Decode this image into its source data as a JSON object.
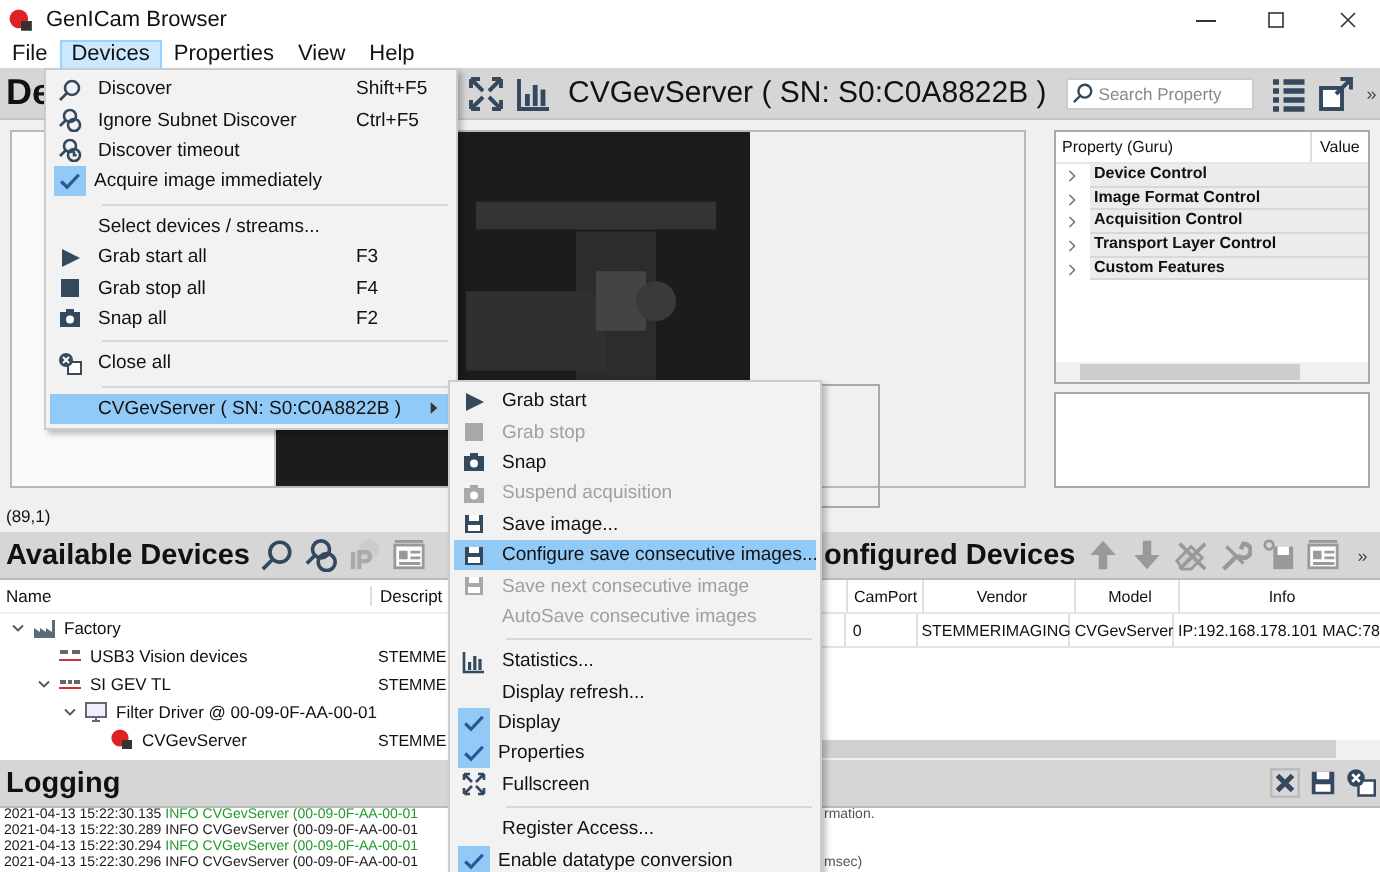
{
  "window": {
    "title": "GenICam Browser"
  },
  "menu_bar": [
    {
      "label": "File",
      "selected": false
    },
    {
      "label": "Devices",
      "selected": true
    },
    {
      "label": "Properties",
      "selected": false
    },
    {
      "label": "View",
      "selected": false
    },
    {
      "label": "Help",
      "selected": false
    }
  ],
  "device_toolbar": {
    "heading": "De",
    "device": "CVGevServer ( SN: S0:C0A8822B )",
    "search": {
      "placeholder": "Search Property"
    },
    "overflow": "»"
  },
  "image_panel": {
    "cursor": "(89,1)"
  },
  "property_tree": {
    "columns": [
      "Property (Guru)",
      "Value"
    ],
    "rows": [
      {
        "label": "Device Control",
        "expanded": false
      },
      {
        "label": "Image Format Control",
        "expanded": false
      },
      {
        "label": "Acquisition Control",
        "expanded": false
      },
      {
        "label": "Transport Layer Control",
        "expanded": false
      },
      {
        "label": "Custom Features",
        "expanded": false
      }
    ]
  },
  "available_devices": {
    "title": "Available Devices",
    "columns": [
      "Name",
      "Descript"
    ],
    "tree": [
      {
        "label": "Factory",
        "expanded": true,
        "children": [
          {
            "label": "USB3 Vision devices",
            "description": "STEMME"
          },
          {
            "label": "SI GEV TL",
            "description": "STEMME",
            "expanded": true,
            "children": [
              {
                "label": "Filter Driver @ 00-09-0F-AA-00-01",
                "expanded": true,
                "children": [
                  {
                    "label": "CVGevServer",
                    "description": "STEMME"
                  }
                ]
              }
            ]
          }
        ]
      }
    ]
  },
  "configured_devices": {
    "title": "onfigured Devices",
    "overflow": "»",
    "columns": [
      "CamPort",
      "Vendor",
      "Model",
      "Info"
    ],
    "rows": [
      [
        "0",
        "STEMMERIMAGING",
        "CVGevServer",
        "IP:192.168.178.101  MAC:78"
      ]
    ]
  },
  "logging": {
    "title": "Logging",
    "lines": [
      {
        "time": "2021-04-13 15:22:30.135",
        "message": "INFO CVGevServer (00-09-0F-AA-00-01",
        "color": "#1f9a2a",
        "tail": "rmation."
      },
      {
        "time": "2021-04-13 15:22:30.289",
        "message": "INFO CVGevServer (00-09-0F-AA-00-01",
        "color": "#1a1a1a"
      },
      {
        "time": "2021-04-13 15:22:30.294",
        "message": "INFO CVGevServer (00-09-0F-AA-00-01",
        "color": "#1f9a2a"
      },
      {
        "time": "2021-04-13 15:22:30.296",
        "message": "INFO CVGevServer (00-09-0F-AA-00-01",
        "color": "#1a1a1a",
        "tail": "msec)"
      }
    ]
  },
  "devices_menu": {
    "items": [
      {
        "kind": "item",
        "label": "Discover",
        "shortcut": "Shift+F5",
        "checked": false,
        "disabled": false,
        "selected": false
      },
      {
        "kind": "item",
        "label": "Ignore Subnet Discover",
        "shortcut": "Ctrl+F5",
        "checked": false,
        "disabled": false,
        "selected": false
      },
      {
        "kind": "item",
        "label": "Discover timeout",
        "checked": false,
        "disabled": false,
        "selected": false
      },
      {
        "kind": "item",
        "label": "Acquire image immediately",
        "checked": true,
        "disabled": false,
        "selected": false
      },
      {
        "kind": "separator"
      },
      {
        "kind": "item",
        "label": "Select devices / streams...",
        "checked": false,
        "disabled": false,
        "selected": false
      },
      {
        "kind": "item",
        "label": "Grab start all",
        "shortcut": "F3",
        "checked": false,
        "disabled": false,
        "selected": false
      },
      {
        "kind": "item",
        "label": "Grab stop all",
        "shortcut": "F4",
        "checked": false,
        "disabled": false,
        "selected": false
      },
      {
        "kind": "item",
        "label": "Snap all",
        "shortcut": "F2",
        "checked": false,
        "disabled": false,
        "selected": false
      },
      {
        "kind": "separator"
      },
      {
        "kind": "item",
        "label": "Close all",
        "checked": false,
        "disabled": false,
        "selected": false
      },
      {
        "kind": "separator"
      },
      {
        "kind": "submenu",
        "label": "CVGevServer ( SN: S0:C0A8822B )",
        "checked": false,
        "disabled": false,
        "selected": true
      }
    ]
  },
  "device_submenu": {
    "items": [
      {
        "kind": "item",
        "label": "Grab start",
        "checked": false,
        "disabled": false,
        "selected": false
      },
      {
        "kind": "item",
        "label": "Grab stop",
        "checked": false,
        "disabled": true,
        "selected": false
      },
      {
        "kind": "item",
        "label": "Snap",
        "checked": false,
        "disabled": false,
        "selected": false
      },
      {
        "kind": "item",
        "label": "Suspend acquisition",
        "checked": false,
        "disabled": true,
        "selected": false
      },
      {
        "kind": "item",
        "label": "Save image...",
        "checked": false,
        "disabled": false,
        "selected": false
      },
      {
        "kind": "item",
        "label": "Configure save consecutive images...",
        "checked": false,
        "disabled": false,
        "selected": true
      },
      {
        "kind": "item",
        "label": "Save next consecutive image",
        "checked": false,
        "disabled": true,
        "selected": false
      },
      {
        "kind": "item",
        "label": "AutoSave consecutive images",
        "checked": false,
        "disabled": true,
        "selected": false
      },
      {
        "kind": "separator"
      },
      {
        "kind": "item",
        "label": "Statistics...",
        "checked": false,
        "disabled": false,
        "selected": false
      },
      {
        "kind": "item",
        "label": "Display refresh...",
        "checked": false,
        "disabled": false,
        "selected": false
      },
      {
        "kind": "item",
        "label": "Display",
        "checked": true,
        "disabled": false,
        "selected": false
      },
      {
        "kind": "item",
        "label": "Properties",
        "checked": true,
        "disabled": false,
        "selected": false
      },
      {
        "kind": "item",
        "label": "Fullscreen",
        "checked": false,
        "disabled": false,
        "selected": false
      },
      {
        "kind": "separator"
      },
      {
        "kind": "item",
        "label": "Register Access...",
        "checked": false,
        "disabled": false,
        "selected": false
      },
      {
        "kind": "item",
        "label": "Enable datatype conversion",
        "checked": true,
        "disabled": false,
        "selected": false
      }
    ]
  }
}
